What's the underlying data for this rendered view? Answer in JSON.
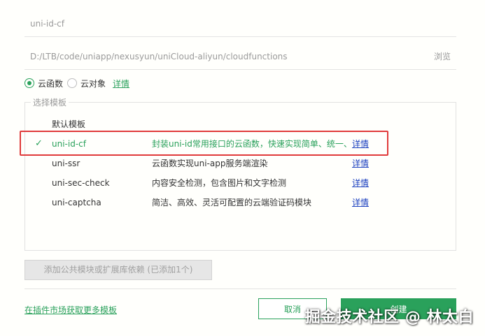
{
  "name_field": {
    "value": "uni-id-cf"
  },
  "path_field": {
    "value": "D:/LTB/code/uniapp/nexusyun/uniCloud-aliyun/cloudfunctions",
    "browse_label": "浏览"
  },
  "type_options": [
    {
      "label": "云函数",
      "selected": true
    },
    {
      "label": "云对象",
      "selected": false
    }
  ],
  "type_detail_label": "详情",
  "templates": {
    "legend": "选择模板",
    "default_label": "默认模板",
    "items": [
      {
        "name": "uni-id-cf",
        "desc": "封装uni-id常用接口的云函数，快速实现简单、统一、",
        "more": "详情",
        "selected": true
      },
      {
        "name": "uni-ssr",
        "desc": "云函数实现uni-app服务端渲染",
        "more": "详情",
        "selected": false
      },
      {
        "name": "uni-sec-check",
        "desc": "内容安全检测，包含图片和文字检测",
        "more": "详情",
        "selected": false
      },
      {
        "name": "uni-captcha",
        "desc": "简洁、高效、灵活可配置的云端验证码模块",
        "more": "详情",
        "selected": false
      }
    ],
    "check_glyph": "✓"
  },
  "dependency_button": "添加公共模块或扩展库依赖 (已添加1个)",
  "market_link": "在插件市场获取更多模板",
  "cancel_label": "取消",
  "create_label": "创建",
  "watermark": "掘金技术社区 @ 林太白",
  "colors": {
    "accent": "#2aa15b",
    "highlight": "#e03a3a",
    "link": "#1a3fbf"
  }
}
